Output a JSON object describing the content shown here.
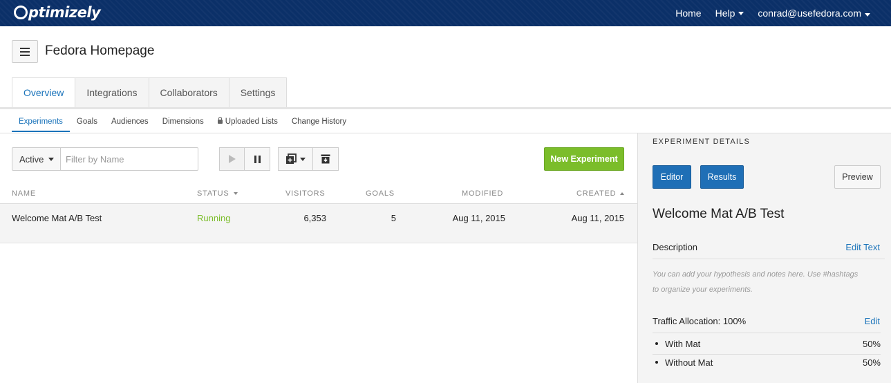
{
  "topbar": {
    "logo": "ptimizely",
    "nav": {
      "home": "Home",
      "help": "Help",
      "account": "conrad@usefedora.com"
    }
  },
  "project": {
    "title": "Fedora Homepage"
  },
  "tabs": [
    {
      "label": "Overview",
      "active": true
    },
    {
      "label": "Integrations"
    },
    {
      "label": "Collaborators"
    },
    {
      "label": "Settings"
    }
  ],
  "subtabs": [
    {
      "label": "Experiments",
      "active": true
    },
    {
      "label": "Goals"
    },
    {
      "label": "Audiences"
    },
    {
      "label": "Dimensions"
    },
    {
      "label": "Uploaded Lists",
      "icon": "lock-icon"
    },
    {
      "label": "Change History"
    }
  ],
  "toolbar": {
    "status_filter": "Active",
    "filter_placeholder": "Filter by Name",
    "new_experiment": "New Experiment",
    "icons": [
      "play-icon",
      "pause-icon",
      "duplicate-icon",
      "archive-icon"
    ]
  },
  "table": {
    "columns": {
      "name": "NAME",
      "status": "STATUS",
      "visitors": "VISITORS",
      "goals": "GOALS",
      "modified": "MODIFIED",
      "created": "CREATED"
    },
    "rows": [
      {
        "name": "Welcome Mat A/B Test",
        "status": "Running",
        "visitors": "6,353",
        "goals": "5",
        "modified": "Aug 11, 2015",
        "created": "Aug 11, 2015"
      }
    ]
  },
  "details": {
    "heading": "EXPERIMENT DETAILS",
    "editor": "Editor",
    "results": "Results",
    "preview": "Preview",
    "experiment_name": "Welcome Mat A/B Test",
    "description_label": "Description",
    "edit_text": "Edit Text",
    "description_line1": "You can add your hypothesis and notes here. Use #hashtags",
    "description_line2": "to organize your experiments.",
    "traffic_label": "Traffic Allocation: 100%",
    "edit": "Edit",
    "variations": [
      {
        "name": "With Mat",
        "pct": "50%"
      },
      {
        "name": "Without Mat",
        "pct": "50%"
      }
    ]
  },
  "colors": {
    "topbar": "#0b3068",
    "accent": "#1a73ba",
    "success": "#7bbd2a",
    "primary_button": "#1f6fb6"
  }
}
